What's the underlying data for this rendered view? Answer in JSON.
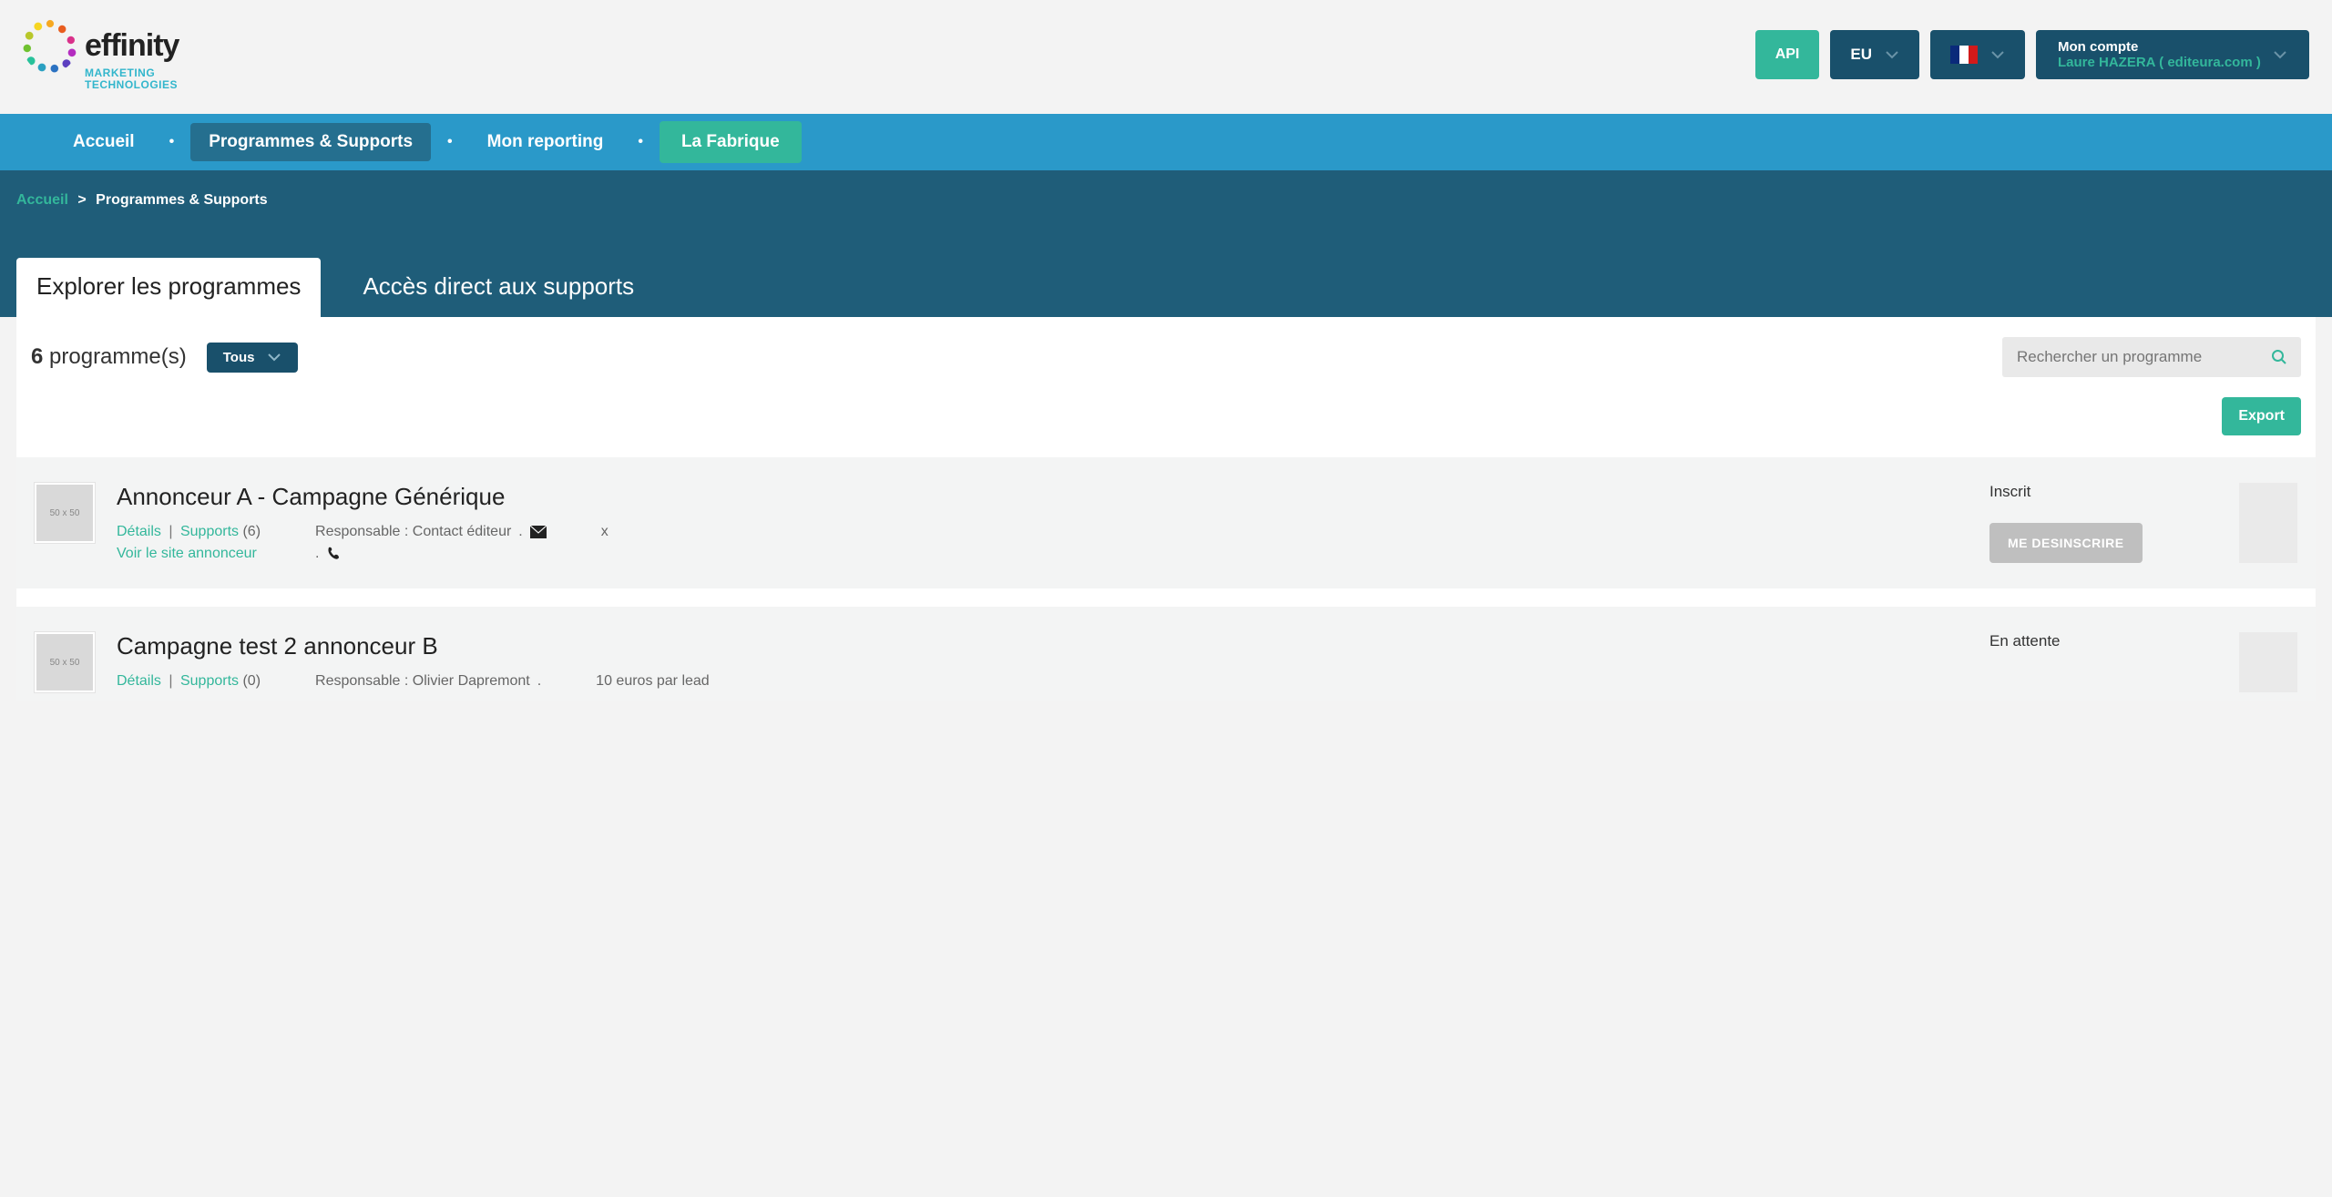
{
  "logo": {
    "word": "effinity",
    "sub1": "MARKETING",
    "sub2": "TECHNOLOGIES"
  },
  "header": {
    "api": "API",
    "region": "EU",
    "account_label": "Mon compte",
    "account_user": "Laure HAZERA",
    "account_domain": "editeura.com"
  },
  "nav": {
    "items": [
      "Accueil",
      "Programmes & Supports",
      "Mon reporting",
      "La Fabrique"
    ],
    "active_index": 1,
    "fab_index": 3
  },
  "breadcrumb": {
    "home": "Accueil",
    "sep": ">",
    "current": "Programmes & Supports"
  },
  "tabs": {
    "items": [
      "Explorer les programmes",
      "Accès direct aux supports"
    ],
    "active_index": 0
  },
  "filter": {
    "count_number": "6",
    "count_label": "programme(s)",
    "dropdown_label": "Tous",
    "search_placeholder": "Rechercher un programme",
    "export_label": "Export"
  },
  "thumb_label": "50 x 50",
  "programs": [
    {
      "title": "Annonceur A - Campagne Générique",
      "details_label": "Détails",
      "supports_label": "Supports",
      "supports_count": "(6)",
      "site_label": "Voir le site annonceur",
      "resp_prefix": "Responsable :",
      "resp_name": "Contact éditeur",
      "extra": "x",
      "status": "Inscrit",
      "unsubscribe": "ME DESINSCRIRE"
    },
    {
      "title": "Campagne test 2 annonceur B",
      "details_label": "Détails",
      "supports_label": "Supports",
      "supports_count": "(0)",
      "site_label": "",
      "resp_prefix": "Responsable :",
      "resp_name": "Olivier Dapremont",
      "extra": "10 euros par lead",
      "status": "En attente",
      "unsubscribe": ""
    }
  ]
}
